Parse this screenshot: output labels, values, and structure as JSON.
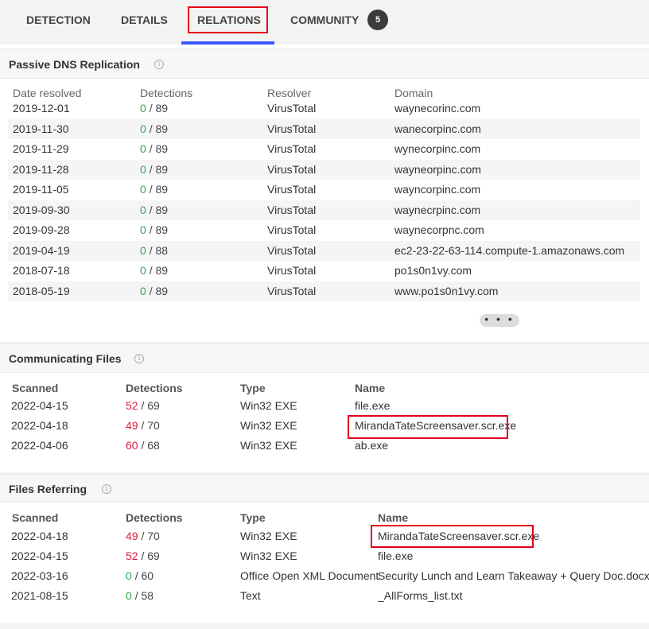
{
  "tabs": {
    "detection": "DETECTION",
    "details": "DETAILS",
    "relations": "RELATIONS",
    "community": "COMMUNITY",
    "community_count": "5"
  },
  "passive_dns": {
    "title": "Passive DNS Replication",
    "headers": [
      "Date resolved",
      "Detections",
      "Resolver",
      "Domain"
    ],
    "rows": [
      {
        "date": "2019-12-01",
        "det": "0",
        "total": "/ 89",
        "resolver": "VirusTotal",
        "domain": "waynecorinc.com"
      },
      {
        "date": "2019-11-30",
        "det": "0",
        "total": "/ 89",
        "resolver": "VirusTotal",
        "domain": "wanecorpinc.com"
      },
      {
        "date": "2019-11-29",
        "det": "0",
        "total": "/ 89",
        "resolver": "VirusTotal",
        "domain": "wynecorpinc.com"
      },
      {
        "date": "2019-11-28",
        "det": "0",
        "total": "/ 89",
        "resolver": "VirusTotal",
        "domain": "wayneorpinc.com"
      },
      {
        "date": "2019-11-05",
        "det": "0",
        "total": "/ 89",
        "resolver": "VirusTotal",
        "domain": "wayncorpinc.com"
      },
      {
        "date": "2019-09-30",
        "det": "0",
        "total": "/ 89",
        "resolver": "VirusTotal",
        "domain": "waynecrpinc.com"
      },
      {
        "date": "2019-09-28",
        "det": "0",
        "total": "/ 89",
        "resolver": "VirusTotal",
        "domain": "waynecorpnc.com"
      },
      {
        "date": "2019-04-19",
        "det": "0",
        "total": "/ 88",
        "resolver": "VirusTotal",
        "domain": "ec2-23-22-63-114.compute-1.amazonaws.com"
      },
      {
        "date": "2018-07-18",
        "det": "0",
        "total": "/ 89",
        "resolver": "VirusTotal",
        "domain": "po1s0n1vy.com"
      },
      {
        "date": "2018-05-19",
        "det": "0",
        "total": "/ 89",
        "resolver": "VirusTotal",
        "domain": "www.po1s0n1vy.com"
      }
    ],
    "more_label": "• • •"
  },
  "communicating_files": {
    "title": "Communicating Files",
    "headers": [
      "Scanned",
      "Detections",
      "Type",
      "Name"
    ],
    "rows": [
      {
        "scanned": "2022-04-15",
        "det": "52",
        "total": "/ 69",
        "type": "Win32 EXE",
        "name": "file.exe"
      },
      {
        "scanned": "2022-04-18",
        "det": "49",
        "total": "/ 70",
        "type": "Win32 EXE",
        "name": "MirandaTateScreensaver.scr.exe"
      },
      {
        "scanned": "2022-04-06",
        "det": "60",
        "total": "/ 68",
        "type": "Win32 EXE",
        "name": "ab.exe"
      }
    ]
  },
  "files_referring": {
    "title": "Files Referring",
    "headers": [
      "Scanned",
      "Detections",
      "Type",
      "Name"
    ],
    "rows": [
      {
        "scanned": "2022-04-18",
        "det": "49",
        "total": "/ 70",
        "type": "Win32 EXE",
        "name": "MirandaTateScreensaver.scr.exe"
      },
      {
        "scanned": "2022-04-15",
        "det": "52",
        "total": "/ 69",
        "type": "Win32 EXE",
        "name": "file.exe"
      },
      {
        "scanned": "2022-03-16",
        "det": "0",
        "total": "/ 60",
        "type": "Office Open XML Document",
        "name": "Security Lunch and Learn Takeaway + Query Doc.docx"
      },
      {
        "scanned": "2021-08-15",
        "det": "0",
        "total": "/ 58",
        "type": "Text",
        "name": "_AllForms_list.txt"
      }
    ]
  },
  "colors": {
    "clean": "#2fa84f",
    "malicious": "#e0193d",
    "tab_active": "#3d5afe",
    "highlight": "#e4001b"
  },
  "icons": {
    "info": "info-circle-icon"
  }
}
